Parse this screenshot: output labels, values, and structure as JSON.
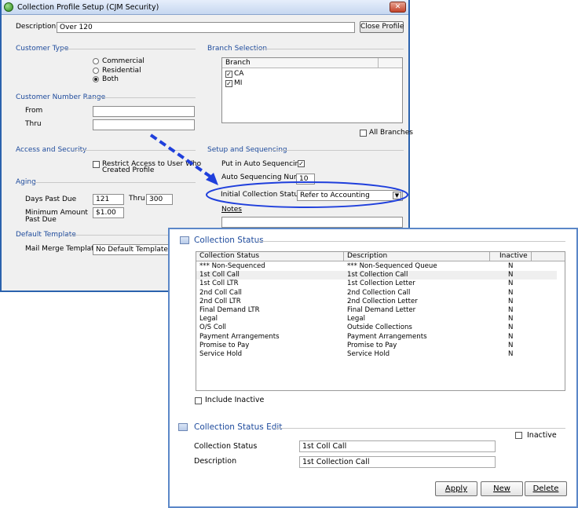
{
  "back_window": {
    "title": "Collection Profile Setup  (CJM Security)",
    "description_label": "Description",
    "description_value": "Over 120",
    "close_profile_label": "Close Profile",
    "customer_type": {
      "heading": "Customer Type",
      "options": [
        "Commercial",
        "Residential",
        "Both"
      ],
      "selected": "Both"
    },
    "branch_selection": {
      "heading": "Branch Selection",
      "column_header": "Branch",
      "branches": [
        {
          "name": "CA",
          "checked": true
        },
        {
          "name": "MI",
          "checked": true
        }
      ],
      "all_branches_label": "All Branches"
    },
    "customer_number_range": {
      "heading": "Customer Number Range",
      "from_label": "From",
      "thru_label": "Thru"
    },
    "access_security": {
      "heading": "Access and Security",
      "restrict_label_line1": "Restrict Access to User Who",
      "restrict_label_line2": "Created Profile"
    },
    "setup_sequencing": {
      "heading": "Setup and Sequencing",
      "auto_seq_label": "Put in Auto Sequencing",
      "auto_seq_number_label": "Auto Sequencing Number",
      "auto_seq_number_value": "10",
      "initial_status_label": "Initial Collection Status",
      "initial_status_value": "Refer to Accounting",
      "notes_label": "Notes"
    },
    "aging": {
      "heading": "Aging",
      "days_past_due_label": "Days Past Due",
      "days_from": "121",
      "thru_label": "Thru",
      "days_thru": "300",
      "min_amount_label_line1": "Minimum Amount",
      "min_amount_label_line2": "Past Due",
      "min_amount_value": "$1.00"
    },
    "default_template": {
      "heading": "Default Template",
      "mail_merge_label": "Mail Merge Template",
      "mail_merge_value": "No Default Template"
    }
  },
  "front_window": {
    "status_heading": "Collection Status",
    "columns": [
      "Collection Status",
      "Description",
      "Inactive"
    ],
    "rows": [
      {
        "status": "*** Non-Sequenced",
        "description": "*** Non-Sequenced Queue",
        "inactive": "N"
      },
      {
        "status": "1st Coll Call",
        "description": "1st Collection Call",
        "inactive": "N"
      },
      {
        "status": "1st Coll LTR",
        "description": "1st Collection Letter",
        "inactive": "N"
      },
      {
        "status": "2nd Coll Call",
        "description": "2nd Collection Call",
        "inactive": "N"
      },
      {
        "status": "2nd Coll LTR",
        "description": "2nd Collection Letter",
        "inactive": "N"
      },
      {
        "status": "Final Demand LTR",
        "description": "Final Demand Letter",
        "inactive": "N"
      },
      {
        "status": "Legal",
        "description": "Legal",
        "inactive": "N"
      },
      {
        "status": "O/S Coll",
        "description": "Outside Collections",
        "inactive": "N"
      },
      {
        "status": "Payment Arrangements",
        "description": "Payment Arrangements",
        "inactive": "N"
      },
      {
        "status": "Promise to Pay",
        "description": "Promise to Pay",
        "inactive": "N"
      },
      {
        "status": "Service Hold",
        "description": "Service Hold",
        "inactive": "N"
      }
    ],
    "include_inactive_label": "Include Inactive",
    "edit_heading": "Collection Status Edit",
    "edit_inactive_label": "Inactive",
    "edit_status_label": "Collection Status",
    "edit_status_value": "1st Coll Call",
    "edit_description_label": "Description",
    "edit_description_value": "1st Collection Call",
    "apply_label": "Apply",
    "new_label": "New",
    "delete_label": "Delete"
  },
  "colors": {
    "section_heading": "#1d4a9c",
    "annotation_blue": "#1f3fdc",
    "front_border": "#5b87c8"
  }
}
